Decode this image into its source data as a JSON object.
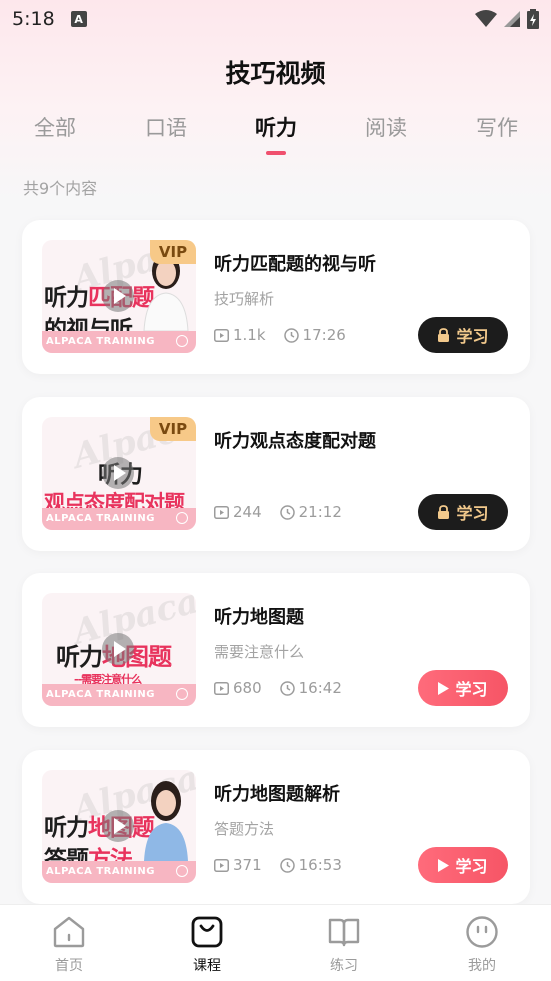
{
  "status_bar": {
    "time": "5:18",
    "notification_icon": "a-icon"
  },
  "header": {
    "title": "技巧视频"
  },
  "tabs": [
    {
      "label": "全部",
      "active": false
    },
    {
      "label": "口语",
      "active": false
    },
    {
      "label": "听力",
      "active": true
    },
    {
      "label": "阅读",
      "active": false
    },
    {
      "label": "写作",
      "active": false
    }
  ],
  "content_count": "共9个内容",
  "colors": {
    "accent": "#f0506e",
    "locked_btn": "#1c1c1c",
    "locked_text": "#f2c98c"
  },
  "cards": [
    {
      "thumb": {
        "line1a": "听力",
        "line1b": "匹配题",
        "line2a": "的视与听",
        "line2b": "",
        "banner": "ALPACA TRAINING",
        "vip": "VIP",
        "has_person": true
      },
      "title": "听力匹配题的视与听",
      "subtitle": "技巧解析",
      "views": "1.1k",
      "duration": "17:26",
      "button_label": "学习",
      "locked": true
    },
    {
      "thumb": {
        "line1a": "听力",
        "line1b": "",
        "line2a": "",
        "line2b": "观点态度配对题",
        "banner": "ALPACA TRAINING",
        "vip": "VIP",
        "has_person": false
      },
      "title": "听力观点态度配对题",
      "subtitle": "",
      "views": "244",
      "duration": "21:12",
      "button_label": "学习",
      "locked": true
    },
    {
      "thumb": {
        "line1a": "听力",
        "line1b": "地图题",
        "line2a": "",
        "line2b": "--需要注意什么",
        "banner": "ALPACA TRAINING",
        "vip": "",
        "has_person": false
      },
      "title": "听力地图题",
      "subtitle": "需要注意什么",
      "views": "680",
      "duration": "16:42",
      "button_label": "学习",
      "locked": false
    },
    {
      "thumb": {
        "line1a": "听力",
        "line1b": "地图题",
        "line2a": "答题",
        "line2b": "方法",
        "banner": "ALPACA TRAINING",
        "vip": "",
        "has_person": true
      },
      "title": "听力地图题解析",
      "subtitle": "答题方法",
      "views": "371",
      "duration": "16:53",
      "button_label": "学习",
      "locked": false
    }
  ],
  "bottom_nav": [
    {
      "label": "首页",
      "icon": "home-icon",
      "active": false
    },
    {
      "label": "课程",
      "icon": "course-icon",
      "active": true
    },
    {
      "label": "练习",
      "icon": "book-icon",
      "active": false
    },
    {
      "label": "我的",
      "icon": "profile-icon",
      "active": false
    }
  ]
}
